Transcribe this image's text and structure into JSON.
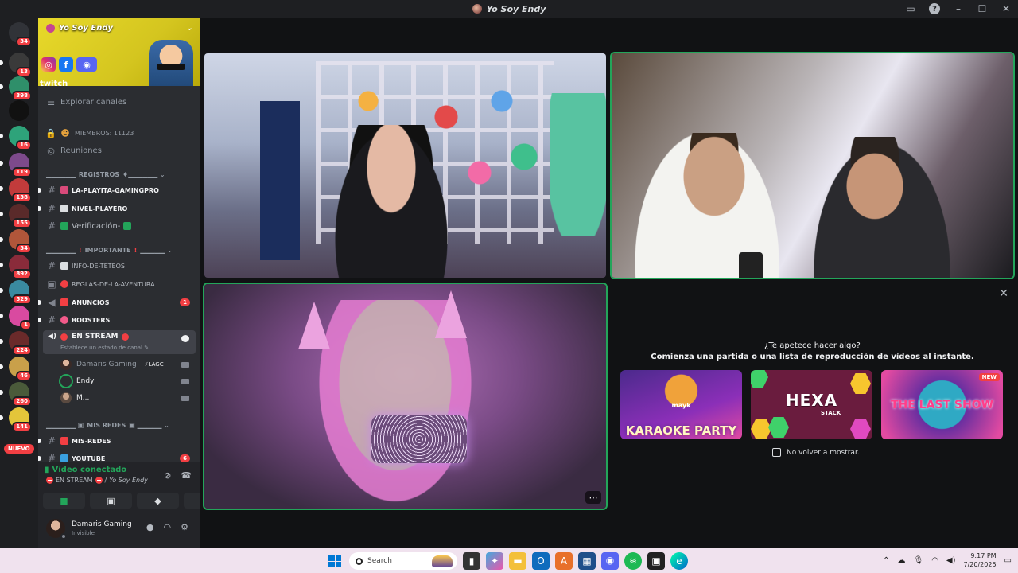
{
  "window": {
    "title": "Yo Soy Endy"
  },
  "server": {
    "name": "Yo Soy Endy",
    "banner_text": "twitch"
  },
  "rail": {
    "badges": [
      "34",
      "13",
      "398",
      "16",
      "119",
      "138",
      "155",
      "34",
      "892",
      "529",
      "1",
      "224",
      "46",
      "260",
      "141"
    ],
    "new_label": "NUEVO"
  },
  "sidebar": {
    "explore": "Explorar canales",
    "members": "MIEMBROS: 11123",
    "meetings": "Reuniones",
    "categories": {
      "registros": "REGISTROS",
      "importante": "IMPORTANTE",
      "mis_redes": "MIS REDES"
    },
    "channels": [
      {
        "label": "LA-PLAYITA-GAMINGPRO"
      },
      {
        "label": "NIVEL-PLAYERO"
      },
      {
        "label": "Verificación-"
      },
      {
        "label": "INFO-DE-TETEOS"
      },
      {
        "label": "REGLAS-DE-LA-AVENTURA"
      },
      {
        "label": "ANUNCIOS",
        "count": "1"
      },
      {
        "label": "BOOSTERS"
      },
      {
        "label": "MIS-REDES"
      },
      {
        "label": "YOUTUBE",
        "count": "6"
      }
    ],
    "stream_channel": {
      "label": "EN STREAM",
      "status": "Establece un estado de canal"
    },
    "voice_users": [
      {
        "name": "Damaris Gaming",
        "tag": "LAGC"
      },
      {
        "name": "Endy"
      },
      {
        "name": "M..."
      }
    ]
  },
  "voice_panel": {
    "status": "Vídeo conectado",
    "channel": "EN STREAM",
    "server": "Yo Soy Endy"
  },
  "user": {
    "name": "Damaris Gaming",
    "status": "Invisible"
  },
  "activity": {
    "question": "¿Te apetece hacer algo?",
    "prompt": "Comienza una partida o una lista de reproducción de vídeos al instante.",
    "games": [
      {
        "title": "KARAOKE PARTY",
        "brand": "mayk"
      },
      {
        "title": "HEXA",
        "sub": "STACK"
      },
      {
        "title": "THE LAST SHOW",
        "badge": "NEW"
      }
    ],
    "dont_show": "No volver a mostrar."
  },
  "taskbar": {
    "search_placeholder": "Search",
    "time": "9:17 PM",
    "date": "7/20/2025"
  },
  "colors": {
    "online_green": "#23a55a",
    "alert_red": "#f23f43",
    "banner_yellow": "#e8d92a"
  }
}
